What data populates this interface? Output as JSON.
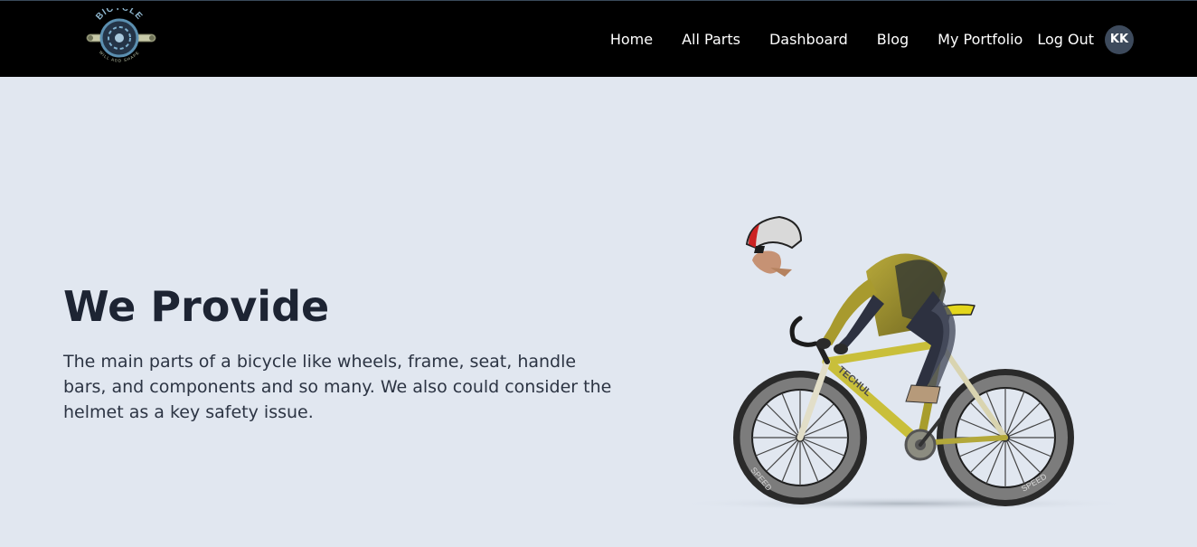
{
  "header": {
    "logo": {
      "text_top": "BICYCLE",
      "text_bottom": "WILL ADD SHAPE"
    },
    "nav": [
      {
        "label": "Home"
      },
      {
        "label": "All Parts"
      },
      {
        "label": "Dashboard"
      },
      {
        "label": "Blog"
      },
      {
        "label": "My Portfolio"
      },
      {
        "label": "Log Out"
      }
    ],
    "avatar_initials": "KK"
  },
  "hero": {
    "title": "We Provide",
    "description": "The main parts of a bicycle like wheels, frame, seat, handle bars, and components and so many. We also could consider the helmet as a key safety issue.",
    "frame_text": "TECHUL",
    "rim_text": "SPEED"
  },
  "colors": {
    "nav_bg": "#000000",
    "page_bg": "#e1e7f0",
    "heading": "#1d2433",
    "avatar_bg": "#3d4a5c",
    "jersey": "#a89a2e",
    "bike_frame": "#c9bf3a"
  }
}
